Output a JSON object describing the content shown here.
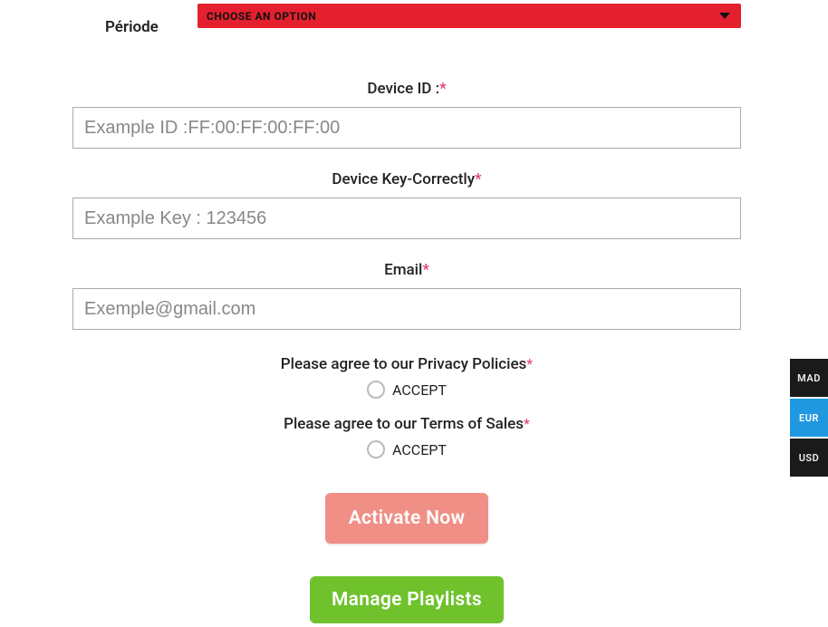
{
  "periode": {
    "label": "Période",
    "select_text": "CHOOSE AN OPTION"
  },
  "fields": {
    "device_id": {
      "label": "Device ID :",
      "placeholder": "Example ID :FF:00:FF:00:FF:00"
    },
    "device_key": {
      "label": "Device Key-Correctly",
      "placeholder": "Example Key : 123456"
    },
    "email": {
      "label": "Email",
      "placeholder": "Exemple@gmail.com"
    }
  },
  "agreements": {
    "privacy": {
      "text": "Please agree to our Privacy Policies",
      "option": "ACCEPT"
    },
    "terms": {
      "text": "Please agree to our Terms of Sales",
      "option": "ACCEPT"
    }
  },
  "buttons": {
    "activate": "Activate Now",
    "manage": "Manage Playlists"
  },
  "required_mark": "*",
  "currencies": [
    "MAD",
    "EUR",
    "USD"
  ]
}
